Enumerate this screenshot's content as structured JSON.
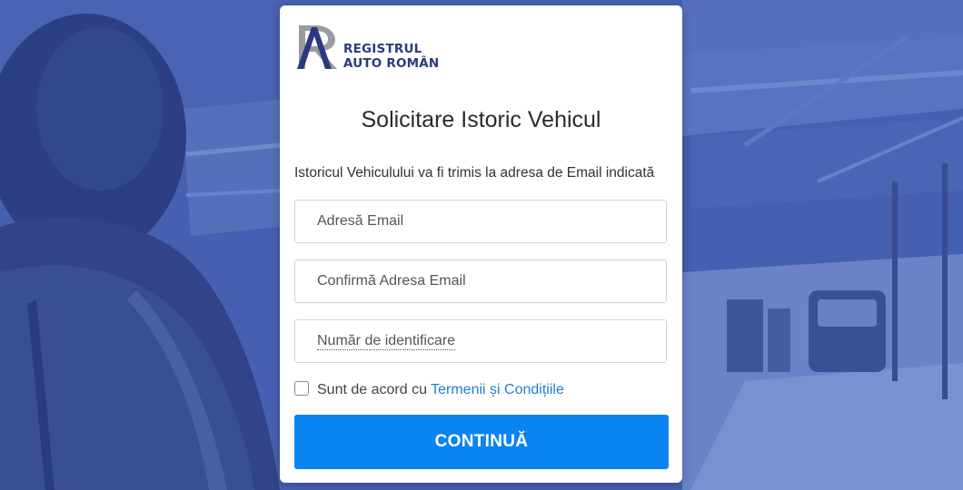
{
  "colors": {
    "background_overlay": "#3d56a6",
    "logo_navy": "#2b3a80",
    "logo_gray": "#9a9aa0",
    "primary_button": "#0a84f0",
    "link": "#1e7dd6"
  },
  "logo": {
    "line1": "REGISTRUL",
    "line2": "AUTO ROMÂN"
  },
  "form": {
    "title": "Solicitare Istoric Vehicul",
    "subtitle": "Istoricul Vehiculului va fi trimis la adresa de Email indicată",
    "email_placeholder": "Adresă Email",
    "confirm_email_placeholder": "Confirmă Adresa Email",
    "id_number_placeholder": "Număr de identificare",
    "agree_text": "Sunt de acord cu ",
    "terms_link": "Termenii și Condițiile",
    "terms_checked": false,
    "submit_label": "CONTINUĂ"
  }
}
